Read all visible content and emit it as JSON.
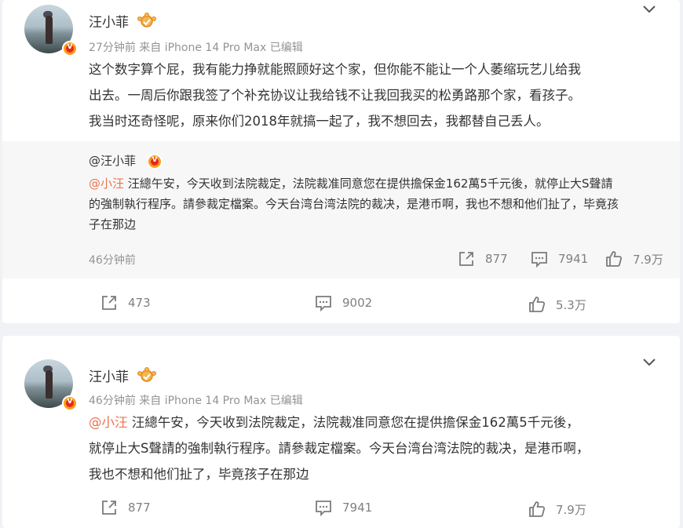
{
  "posts": [
    {
      "user": {
        "name": "汪小菲",
        "verified_badge": "V"
      },
      "meta": "27分钟前 来自 iPhone 14 Pro Max 已编辑",
      "text_lines": [
        "这个数字算个屁，我有能力挣就能照顾好这个家，但你能不能让一个人萎缩玩艺儿给我",
        "出去。一周后你跟我签了个补充协议让我给钱不让我回我买的松勇路那个家，看孩子。",
        "我当时还奇怪呢，原来你们2018年就搞一起了，我不想回去，我都替自己丢人。"
      ],
      "repost": {
        "name": "@汪小菲",
        "mention": "@小汪",
        "text_first": " 汪總午安，今天收到法院裁定，法院裁准同意您在提供擔保金162萬5千元後，就停止大S聲請",
        "text_lines": [
          "的強制執行程序。請參裁定檔案。今天台湾台湾法院的裁决，是港币啊，我也不想和他们扯了，毕竟孩",
          "子在那边"
        ],
        "time": "46分钟前",
        "share_count": "877",
        "comment_count": "7941",
        "like_count": "7.9万"
      },
      "actions": {
        "share": "473",
        "comment": "9002",
        "like": "5.3万"
      }
    },
    {
      "user": {
        "name": "汪小菲",
        "verified_badge": "V"
      },
      "meta": "46分钟前 来自 iPhone 14 Pro Max 已编辑",
      "mention": "@小汪",
      "text_first": " 汪總午安，今天收到法院裁定，法院裁准同意您在提供擔保金162萬5千元後，",
      "text_lines": [
        "就停止大S聲請的強制執行程序。請參裁定檔案。今天台湾台湾法院的裁决，是港币啊，",
        "我也不想和他们扯了，毕竟孩子在那边"
      ],
      "actions": {
        "share": "877",
        "comment": "7941",
        "like": "7.9万"
      }
    }
  ],
  "colors": {
    "mention": "#eb7350",
    "meta": "#939393",
    "background": "#f1f2f5",
    "repost_bg": "#f7f7f7"
  },
  "icons": [
    "share-icon",
    "comment-icon",
    "like-icon",
    "chevron-down-icon",
    "crown-icon",
    "verified-icon"
  ]
}
